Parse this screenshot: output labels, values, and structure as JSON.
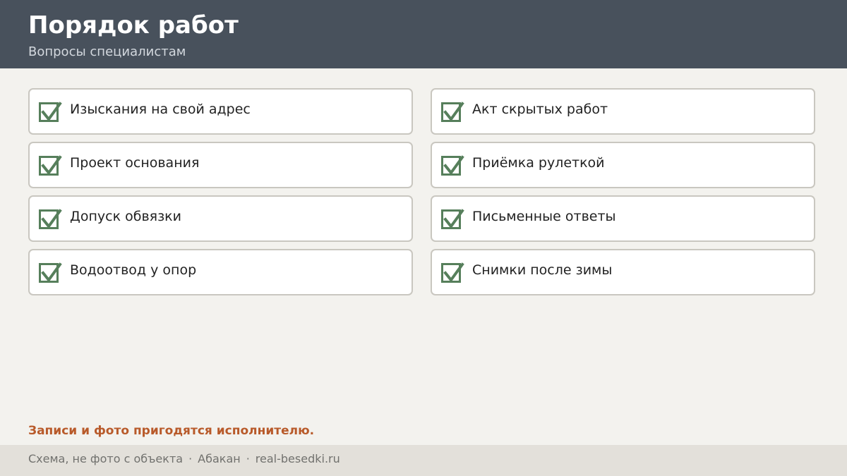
{
  "header": {
    "title": "Порядок работ",
    "subtitle": "Вопросы специалистам"
  },
  "colors": {
    "header_bg": "#48515c",
    "accent_green": "#567f5b",
    "note_orange": "#b85a2a",
    "page_bg": "#f3f2ee"
  },
  "items": [
    {
      "label": "Изыскания на свой адрес",
      "checked": true
    },
    {
      "label": "Проект основания",
      "checked": true
    },
    {
      "label": "Допуск обвязки",
      "checked": true
    },
    {
      "label": "Водоотвод у опор",
      "checked": true
    },
    {
      "label": "Акт скрытых работ",
      "checked": true
    },
    {
      "label": "Приёмка рулеткой",
      "checked": true
    },
    {
      "label": "Письменные ответы",
      "checked": true
    },
    {
      "label": "Снимки после зимы",
      "checked": true
    }
  ],
  "note": "Записи и фото пригодятся исполнителю.",
  "footer": {
    "caption": "Схема, не фото с объекта",
    "separator": "·",
    "city": "Абакан",
    "site": "real-besedki.ru"
  }
}
